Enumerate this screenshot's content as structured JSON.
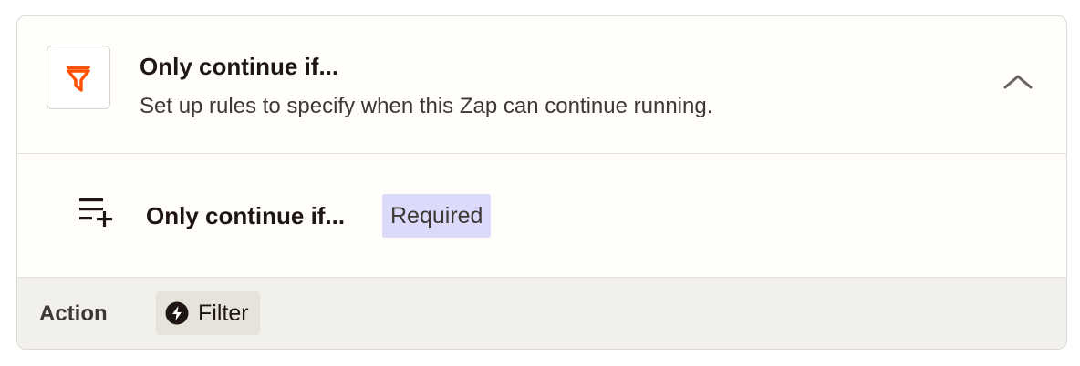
{
  "step": {
    "title": "Only continue if...",
    "description": "Set up rules to specify when this Zap can continue running.",
    "icon": "filter-funnel-icon",
    "accent_color": "#ff4f00"
  },
  "field": {
    "label": "Only continue if...",
    "badge": "Required",
    "icon": "list-add-icon"
  },
  "footer": {
    "label": "Action",
    "chip_label": "Filter",
    "chip_icon": "bolt-icon"
  }
}
